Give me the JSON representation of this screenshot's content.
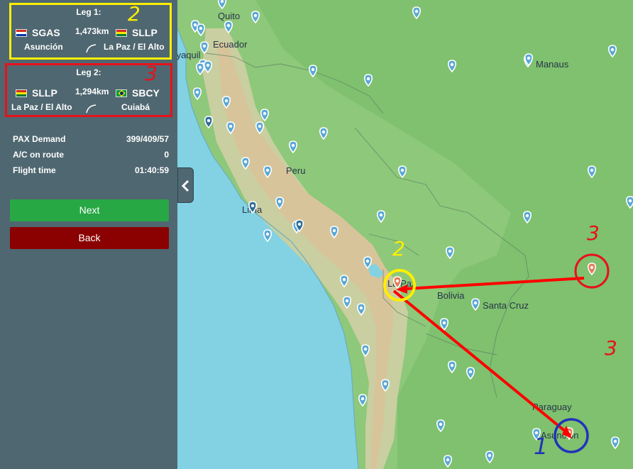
{
  "legs": [
    {
      "title": "Leg 1:",
      "origin_code": "SGAS",
      "origin_city": "Asunción",
      "distance": "1,473km",
      "dest_code": "SLLP",
      "dest_city": "La Paz / El Alto"
    },
    {
      "title": "Leg 2:",
      "origin_code": "SLLP",
      "origin_city": "La Paz / El Alto",
      "distance": "1,294km",
      "dest_code": "SBCY",
      "dest_city": "Cuiabá"
    }
  ],
  "stats": [
    {
      "label": "PAX Demand",
      "value": "399/409/57"
    },
    {
      "label": "A/C on route",
      "value": "0"
    },
    {
      "label": "Flight time",
      "value": "01:40:59"
    }
  ],
  "buttons": {
    "next": "Next",
    "back": "Back"
  },
  "map_labels": {
    "quito": "Quito",
    "ecuador": "Ecuador",
    "guayaquil": "Guayaquil",
    "peru": "Peru",
    "lima": "Lima",
    "manaus": "Manaus",
    "lapaz": "La Paz",
    "bolivia": "Bolivia",
    "santacruz": "Santa Cruz",
    "paraguay": "Paraguay",
    "asuncion": "Asunción"
  },
  "annotations": {
    "leg1_number": "2",
    "leg2_number": "3",
    "map_lapaz": "2",
    "map_cuiaba": "3",
    "map_asuncion": "1"
  },
  "colors": {
    "sidebar": "#4f6770",
    "next": "#28a745",
    "back": "#8b0000",
    "route": "#ff0000",
    "annot_yellow": "#ffef00",
    "annot_red": "#e8111b",
    "annot_blue": "#2233bb"
  }
}
